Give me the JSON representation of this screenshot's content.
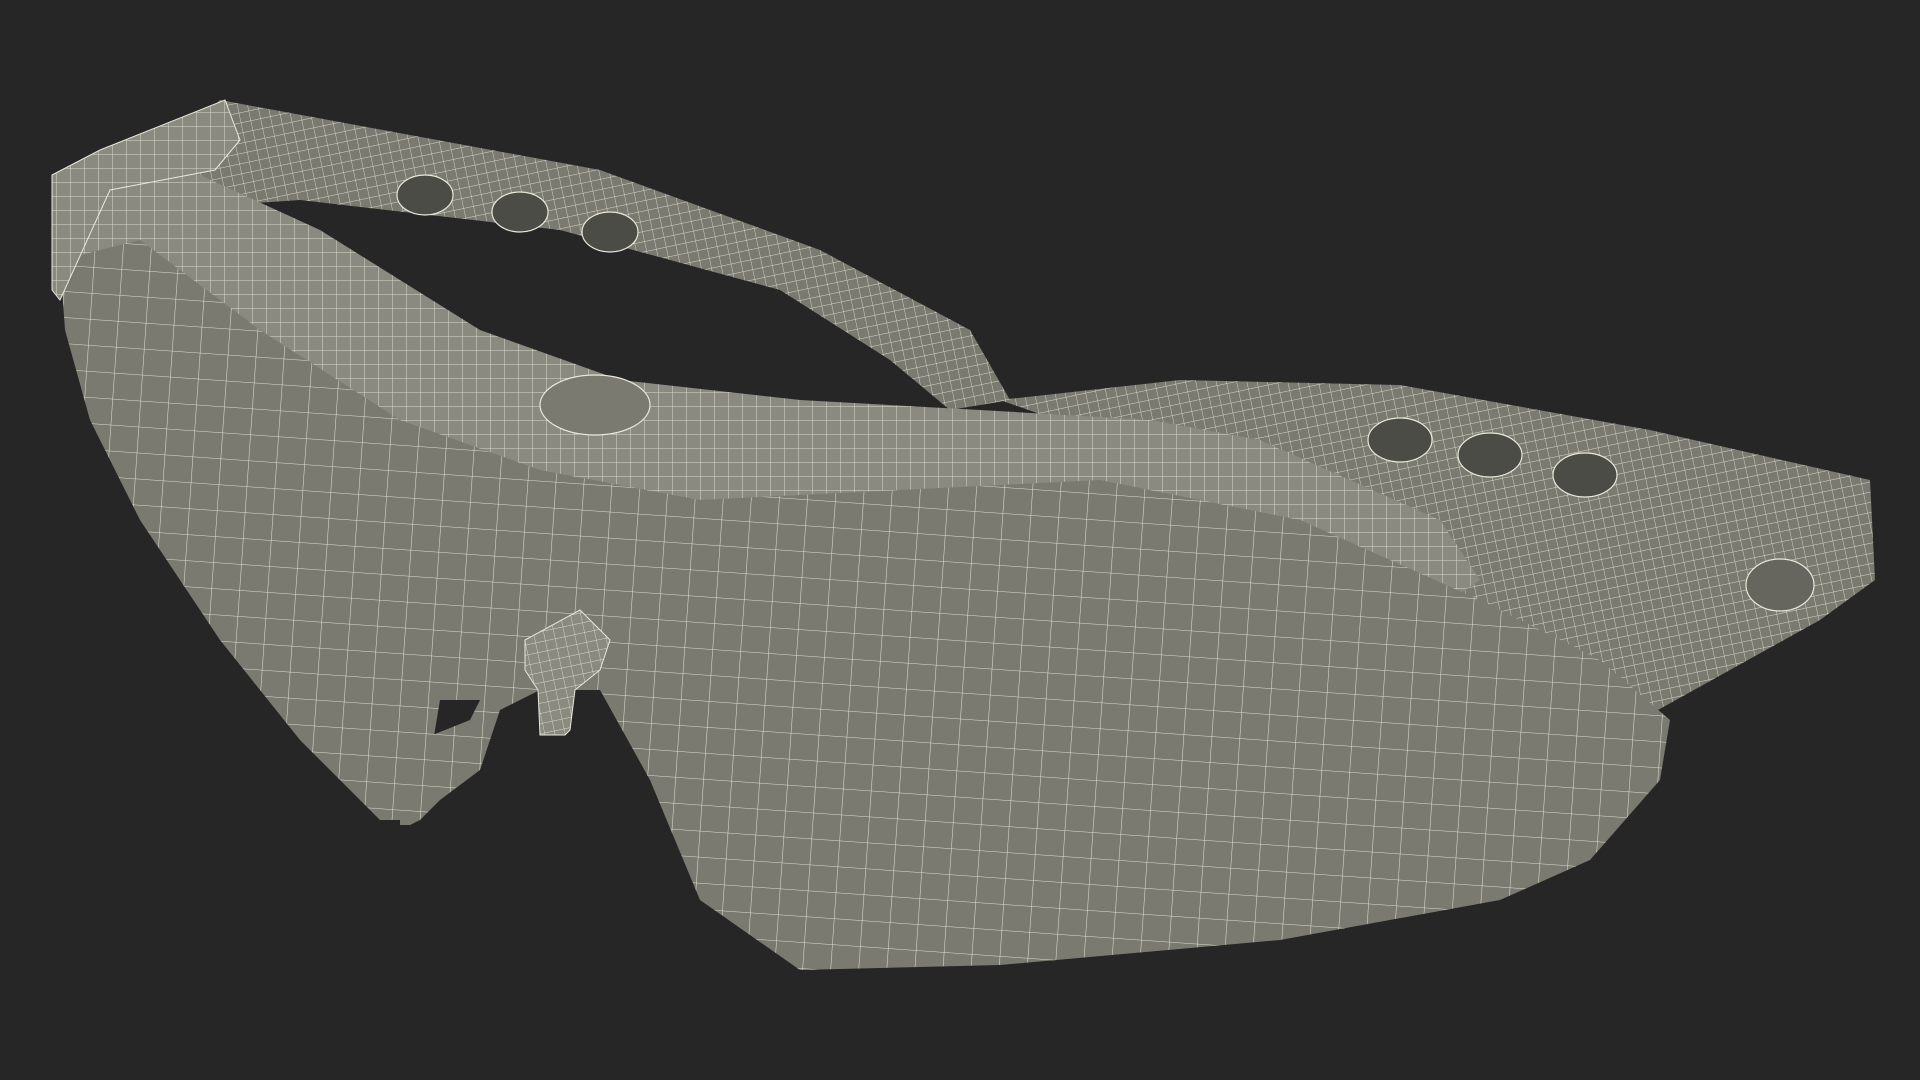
{
  "scene": {
    "subject": "wireframe-safety-glasses",
    "colors": {
      "background": "#262626",
      "surface": "#7a7a70",
      "surface_dark": "#66665e",
      "surface_light": "#8a8a80",
      "wire": "#e8e8da",
      "hole": "#4c4c46"
    }
  }
}
